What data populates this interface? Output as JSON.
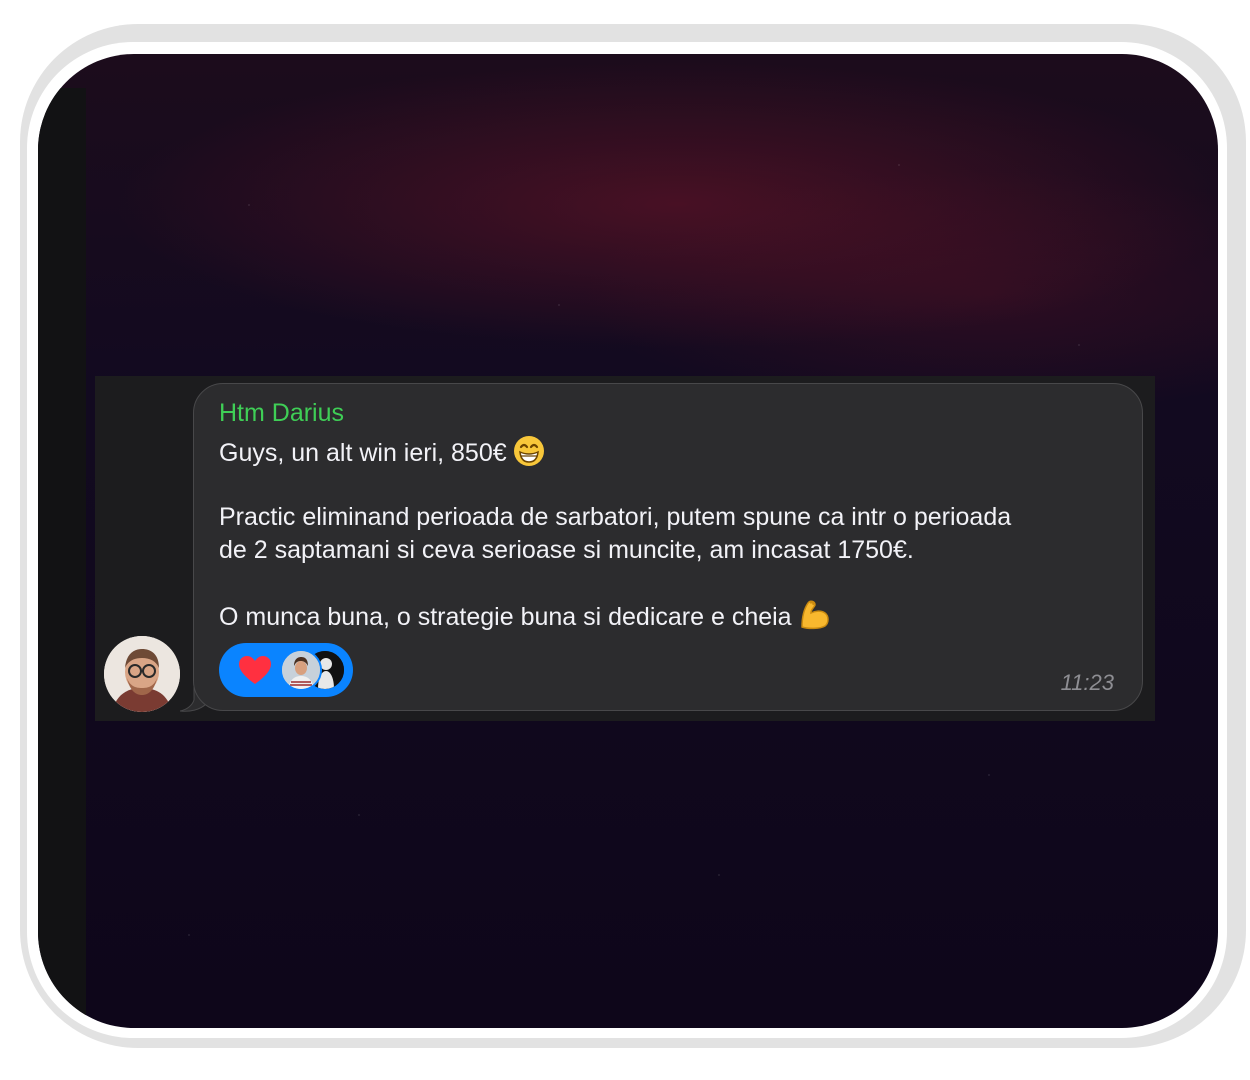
{
  "message": {
    "sender_name": "Htm Darius",
    "line_1": "Guys, un alt win ieri, 850€",
    "line_2": "Practic eliminand perioada de sarbatori, putem spune ca intr o perioada",
    "line_3": "de 2 saptamani si ceva serioase si muncite, am incasat 1750€.",
    "line_4": "O munca buna, o strategie buna si dedicare e cheia",
    "emoji_1": "grinning-face-with-smiling-eyes-icon",
    "emoji_2": "flexed-biceps-icon",
    "time": "11:23"
  },
  "reactions": {
    "emoji": "heart-icon",
    "reactor_count_shown": 2
  },
  "colors": {
    "sender": "#3fce56",
    "bubble": "#2c2c2e",
    "text": "#f2f2f7",
    "time": "#8e8e93",
    "reaction_pill": "#0a84ff"
  }
}
